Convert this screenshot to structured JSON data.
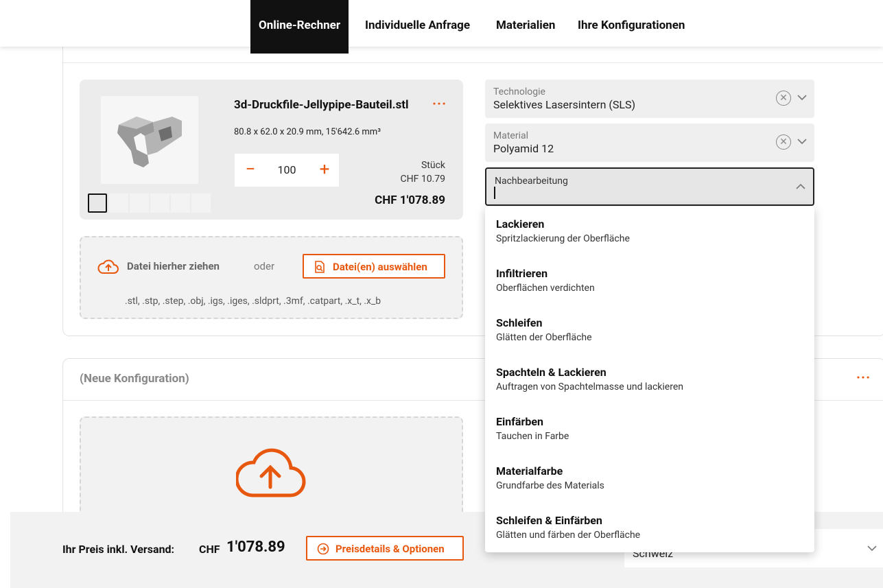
{
  "nav": {
    "tabs": [
      {
        "label": "Online-Rechner",
        "active": true
      },
      {
        "label": "Individuelle Anfrage"
      },
      {
        "label": "Materialien"
      },
      {
        "label": "Ihre Konfigurationen"
      }
    ]
  },
  "file": {
    "name": "3d-Druckfile-Jellypipe-Bauteil.stl",
    "more": "···",
    "dimensions": "80.8 x 62.0 x 20.9 mm, 15'642.6 mm³",
    "quantity": "100",
    "unit_label": "Stück",
    "unit_price": "CHF 10.79",
    "total": "CHF 1'078.89"
  },
  "upload": {
    "drag_text": "Datei hierher ziehen",
    "or": "oder",
    "button": "Datei(en) auswählen",
    "formats": ".stl, .stp, .step, .obj, .igs, .iges, .sldprt, .3mf, .catpart, .x_t, .x_b"
  },
  "fields": {
    "technology": {
      "label": "Technologie",
      "value": "Selektives Lasersintern (SLS)"
    },
    "material": {
      "label": "Material",
      "value": "Polyamid 12"
    },
    "postprocessing": {
      "label": "Nachbearbeitung",
      "value": ""
    }
  },
  "menu": [
    {
      "title": "Lackieren",
      "subtitle": "Spritzlackierung der Oberfläche"
    },
    {
      "title": "Infiltrieren",
      "subtitle": "Oberflächen verdichten"
    },
    {
      "title": "Schleifen",
      "subtitle": "Glätten der Oberfläche"
    },
    {
      "title": "Spachteln & Lackieren",
      "subtitle": "Auftragen von Spachtelmasse und lackieren"
    },
    {
      "title": "Einfärben",
      "subtitle": "Tauchen in Farbe"
    },
    {
      "title": "Materialfarbe",
      "subtitle": "Grundfarbe des Materials"
    },
    {
      "title": "Schleifen & Einfärben",
      "subtitle": "Glätten und färben der Oberfläche"
    }
  ],
  "config2": {
    "title": "(Neue Konfiguration)",
    "more": "···"
  },
  "footer": {
    "price_label": "Ihr Preis inkl. Versand:",
    "currency": "CHF",
    "price": "1'078.89",
    "details_button": "Preisdetails & Optionen",
    "country": "Schweiz"
  },
  "colors": {
    "accent": "#e8570e",
    "nav_active": "#111111"
  },
  "icons": [
    "cloud-upload-icon",
    "file-search-icon",
    "arrow-circle-right-icon",
    "chevron-down-icon",
    "chevron-up-icon",
    "clear-icon"
  ]
}
